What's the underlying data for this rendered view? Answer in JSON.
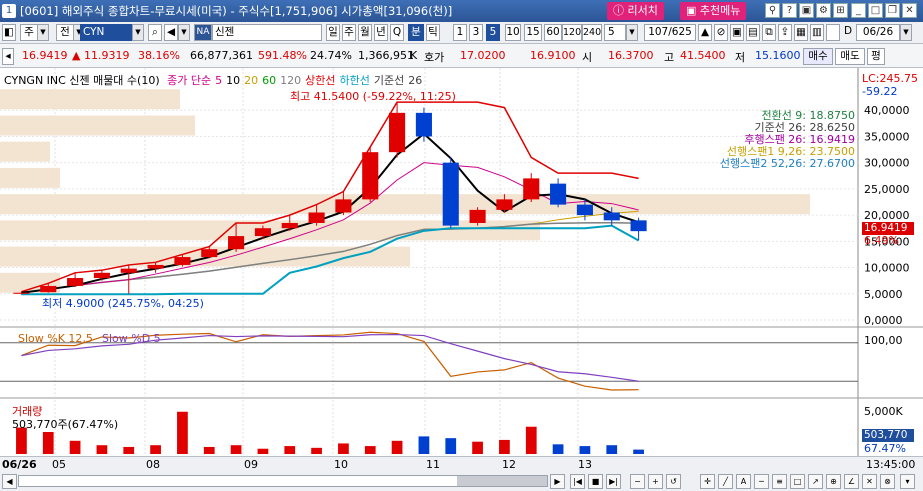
{
  "window": {
    "number": "1",
    "title": "[0601] 해외주식 종합차트-무료시세(미국) - 주식수[1,751,906] 시가총액[31,096(천)]",
    "buttons": {
      "ritcher": "리서치",
      "recommend": "추천메뉴"
    }
  },
  "toolbar": {
    "market": "주",
    "type": "전",
    "code": "CYN",
    "na_badge": "NA",
    "stock_name": "신젠",
    "periods": [
      "일",
      "주",
      "월",
      "년",
      "Q",
      "분",
      "틱"
    ],
    "selected_period": "분",
    "minutes": [
      "1",
      "3",
      "5",
      "10",
      "15",
      "60",
      "120",
      "240"
    ],
    "selected_minute": "5",
    "interval_value": "5",
    "count": "107/625",
    "date": "06/26"
  },
  "quote": {
    "price": "16.9419",
    "change_arrow": "▲",
    "change": "11.9319",
    "change_pct": "38.16%",
    "volume": "66,877,361",
    "volume_pct": "591.48%",
    "turnover": "24.74%",
    "shares": "1,366,951",
    "unit": "K",
    "bid_label": "호가",
    "bid": "17.0200",
    "ask": "16.9100",
    "open_label": "시",
    "open": "16.3700",
    "high_label": "고",
    "high": "41.5400",
    "low_label": "저",
    "low": "15.1600",
    "buy": "매수",
    "sell": "매도",
    "eval": "평"
  },
  "chart": {
    "title": "CYNGN INC  신젠 매물대 수(10)",
    "legend": [
      {
        "text": "종가 단순",
        "color": "#d0008a"
      },
      {
        "text": "5",
        "color": "#d0008a"
      },
      {
        "text": "10",
        "color": "#000000"
      },
      {
        "text": "20",
        "color": "#c8a000"
      },
      {
        "text": "60",
        "color": "#00a000"
      },
      {
        "text": "120",
        "color": "#808080"
      },
      {
        "text": "상한선",
        "color": "#e00000"
      },
      {
        "text": "하한선",
        "color": "#00a0c0"
      },
      {
        "text": "기준선",
        "color": "#404040"
      },
      {
        "text": "26",
        "color": "#404040"
      }
    ],
    "lc_label": "LC:245.75",
    "lc_pct": "-59.22",
    "max_label": "최고 41.5400 (-59.22%, 11:25)",
    "min_label": "최저 4.9000 (245.75%, 04:25)",
    "ichimoku": [
      {
        "text": "전환선 9: 18.8750",
        "color": "#208040"
      },
      {
        "text": "기준선 26: 28.6250",
        "color": "#404040"
      },
      {
        "text": "후행스팬 26: 16.9419",
        "color": "#a000a0"
      },
      {
        "text": "선행스팬1 9,26: 23.7500",
        "color": "#c8a000"
      },
      {
        "text": "선행스팬2 52,26: 27.6700",
        "color": "#2080c0"
      }
    ],
    "y_ticks": [
      "40,0000",
      "35,0000",
      "30,0000",
      "25,0000",
      "20,0000",
      "15,0000",
      "10,0000",
      "5,0000",
      "0,0000"
    ],
    "current_price_tag": "16.9419",
    "current_pct_tag": "6.49%",
    "stoch_label_k": "Slow %K 12,5",
    "stoch_label_d": "Slow %D 5",
    "stoch_tick": "100,00",
    "volume_title": "거래량",
    "volume_value": "503,770주(67.47%)",
    "volume_tick": "5,000K",
    "volume_tag": "503,770",
    "volume_pct_tag": "67.47%",
    "x_labels": [
      "06/26",
      "05",
      "08",
      "09",
      "10",
      "11",
      "12",
      "13"
    ],
    "time_label": "13:45:00"
  },
  "chart_data": {
    "type": "candlestick",
    "title": "CYNGN INC  신젠 매물대 수(10)",
    "ylim": [
      0,
      45
    ],
    "y_ticks": [
      0,
      5,
      10,
      15,
      20,
      25,
      30,
      35,
      40
    ],
    "candles": [
      {
        "t": "04",
        "o": 5.0,
        "c": 5.2,
        "h": 5.4,
        "l": 4.9
      },
      {
        "t": "05",
        "o": 5.3,
        "c": 6.5,
        "h": 7.0,
        "l": 5.2
      },
      {
        "t": "06",
        "o": 6.5,
        "c": 8.0,
        "h": 9.0,
        "l": 6.3
      },
      {
        "t": "07",
        "o": 8.0,
        "c": 9.0,
        "h": 9.5,
        "l": 7.5
      },
      {
        "t": "08",
        "o": 9.0,
        "c": 9.8,
        "h": 10.5,
        "l": 5.0
      },
      {
        "t": "08",
        "o": 9.8,
        "c": 10.5,
        "h": 11.0,
        "l": 9.0
      },
      {
        "t": "09",
        "o": 10.5,
        "c": 12.0,
        "h": 12.5,
        "l": 10.2
      },
      {
        "t": "09",
        "o": 12.0,
        "c": 13.5,
        "h": 14.0,
        "l": 11.8
      },
      {
        "t": "10",
        "o": 13.5,
        "c": 16.0,
        "h": 18.5,
        "l": 13.0
      },
      {
        "t": "10",
        "o": 16.0,
        "c": 17.5,
        "h": 18.0,
        "l": 15.5
      },
      {
        "t": "10",
        "o": 17.5,
        "c": 18.5,
        "h": 20.0,
        "l": 17.0
      },
      {
        "t": "10",
        "o": 18.5,
        "c": 20.5,
        "h": 22.0,
        "l": 18.0
      },
      {
        "t": "11",
        "o": 20.5,
        "c": 23.0,
        "h": 24.5,
        "l": 20.0
      },
      {
        "t": "11",
        "o": 23.0,
        "c": 32.0,
        "h": 33.0,
        "l": 22.5
      },
      {
        "t": "11",
        "o": 32.0,
        "c": 39.5,
        "h": 41.54,
        "l": 31.0
      },
      {
        "t": "11",
        "o": 39.5,
        "c": 35.0,
        "h": 40.5,
        "l": 34.0
      },
      {
        "t": "12",
        "o": 30.0,
        "c": 18.0,
        "h": 31.0,
        "l": 17.5
      },
      {
        "t": "12",
        "o": 18.5,
        "c": 21.0,
        "h": 21.5,
        "l": 18.0
      },
      {
        "t": "12",
        "o": 21.0,
        "c": 23.0,
        "h": 24.0,
        "l": 20.5
      },
      {
        "t": "12",
        "o": 23.0,
        "c": 27.0,
        "h": 28.0,
        "l": 22.5
      },
      {
        "t": "13",
        "o": 26.0,
        "c": 22.0,
        "h": 27.0,
        "l": 21.5
      },
      {
        "t": "13",
        "o": 22.0,
        "c": 20.0,
        "h": 23.0,
        "l": 19.0
      },
      {
        "t": "13",
        "o": 20.5,
        "c": 19.0,
        "h": 21.5,
        "l": 18.0
      },
      {
        "t": "13",
        "o": 19.0,
        "c": 16.94,
        "h": 19.5,
        "l": 15.16
      }
    ],
    "volume": [
      3.0,
      2.5,
      1.5,
      1.0,
      0.8,
      1.0,
      4.8,
      0.8,
      1.0,
      0.6,
      0.9,
      0.7,
      1.2,
      0.9,
      1.5,
      2.0,
      1.8,
      1.4,
      1.6,
      3.1,
      1.1,
      0.9,
      1.0,
      0.5
    ]
  }
}
